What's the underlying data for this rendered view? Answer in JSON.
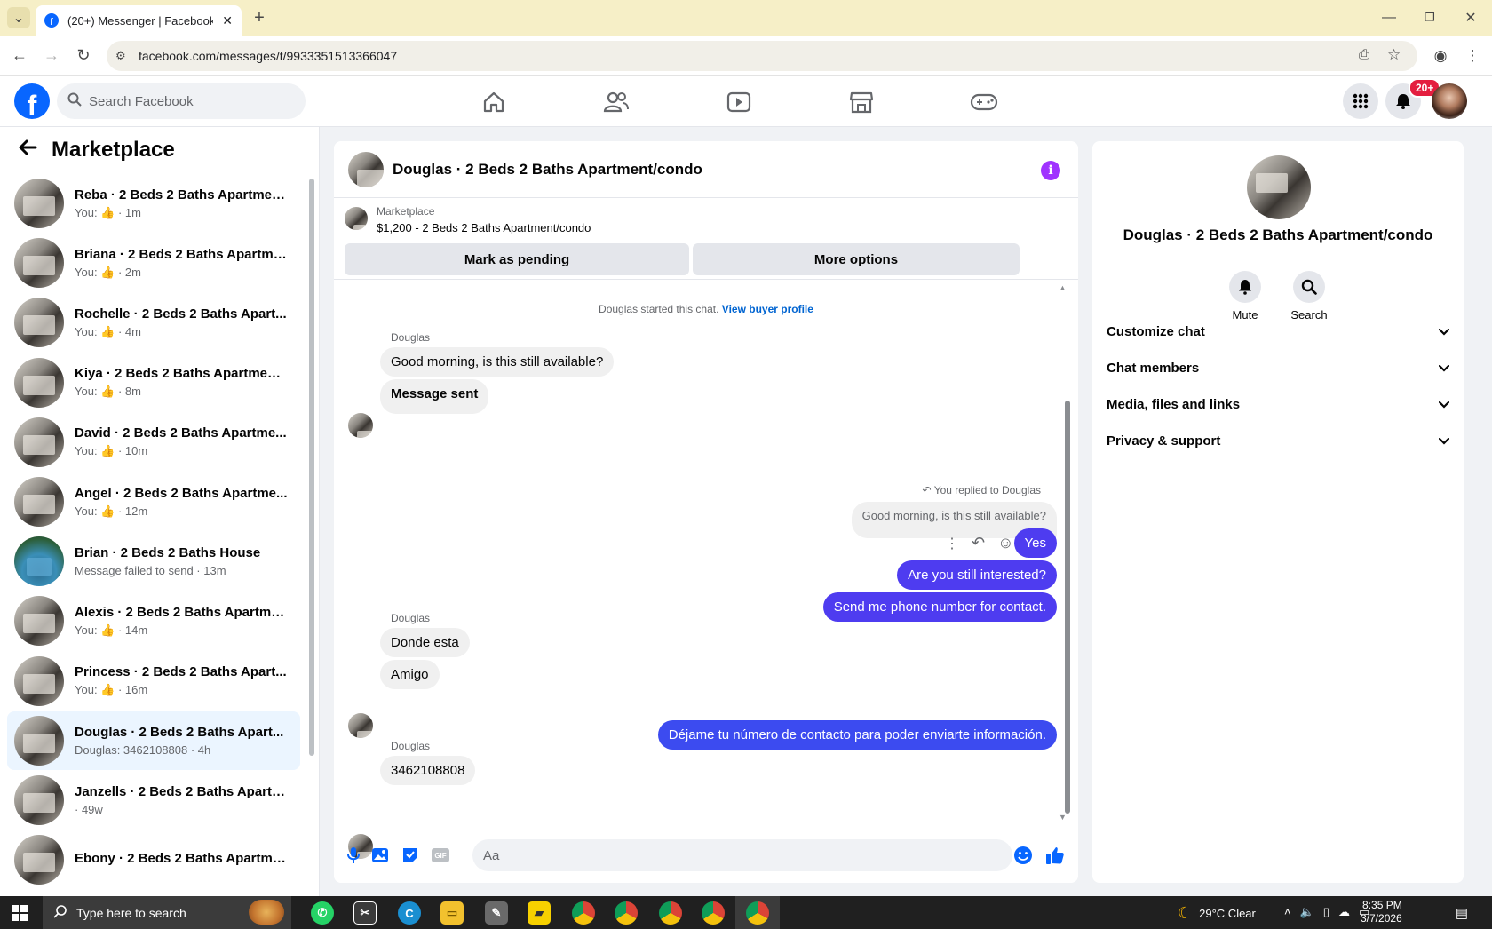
{
  "browser": {
    "tab_title": "(20+) Messenger | Facebook",
    "url": "facebook.com/messages/t/9933351513366047"
  },
  "header": {
    "search_placeholder": "Search Facebook",
    "notification_badge": "20+"
  },
  "sidebar": {
    "title": "Marketplace",
    "conversations": [
      {
        "name": "Reba · 2 Beds 2 Baths Apartmen...",
        "sub": "You: 👍 · 1m",
        "type": "apt"
      },
      {
        "name": "Briana · 2 Beds 2 Baths Apartme...",
        "sub": "You: 👍 · 2m",
        "type": "apt"
      },
      {
        "name": "Rochelle · 2 Beds 2 Baths Apart...",
        "sub": "You: 👍 · 4m",
        "type": "apt"
      },
      {
        "name": "Kiya · 2 Beds 2 Baths Apartment...",
        "sub": "You: 👍 · 8m",
        "type": "apt"
      },
      {
        "name": "David · 2 Beds 2 Baths Apartme...",
        "sub": "You: 👍 · 10m",
        "type": "apt"
      },
      {
        "name": "Angel · 2 Beds 2 Baths Apartme...",
        "sub": "You: 👍 · 12m",
        "type": "apt"
      },
      {
        "name": "Brian · 2 Beds 2 Baths House",
        "sub": "Message failed to send · 13m",
        "type": "house"
      },
      {
        "name": "Alexis · 2 Beds 2 Baths Apartme...",
        "sub": "You: 👍 · 14m",
        "type": "apt"
      },
      {
        "name": "Princess · 2 Beds 2 Baths Apart...",
        "sub": "You: 👍 · 16m",
        "type": "apt"
      },
      {
        "name": "Douglas · 2 Beds 2 Baths Apart...",
        "sub": "Douglas: 3462108808 · 4h",
        "type": "apt"
      },
      {
        "name": "Janzells · 2 Beds 2 Baths Apartm...",
        "sub": "· 49w",
        "type": "apt"
      },
      {
        "name": "Ebony · 2 Beds 2 Baths Apartme...",
        "sub": "",
        "type": "apt"
      }
    ]
  },
  "chat": {
    "title": "Douglas · 2 Beds 2 Baths Apartment/condo",
    "marketplace_label": "Marketplace",
    "listing": "$1,200 - 2 Beds 2 Baths Apartment/condo",
    "mark_pending": "Mark as pending",
    "more_options": "More options",
    "started": "Douglas started this chat.",
    "view_profile": "View buyer profile",
    "sender": "Douglas",
    "msg1": "Good morning, is this still available?",
    "msg2": "Message sent",
    "replied": "You replied to Douglas",
    "quoted": "Good morning, is this still available?",
    "out1": "Yes",
    "out2": "Are you still interested?",
    "out3": "Send me phone number for contact.",
    "msg3": "Donde esta",
    "msg4": "Amigo",
    "out4": "Déjame tu número de contacto para poder enviarte información.",
    "msg5": "3462108808",
    "input_placeholder": "Aa"
  },
  "info": {
    "name": "Douglas · 2 Beds 2 Baths Apartment/condo",
    "mute": "Mute",
    "search": "Search",
    "rows": [
      "Customize chat",
      "Chat members",
      "Media, files and links",
      "Privacy & support"
    ]
  },
  "taskbar": {
    "search_placeholder": "Type here to search",
    "weather": "29°C  Clear",
    "time": "8:35 PM",
    "date": "3/7/2026"
  }
}
